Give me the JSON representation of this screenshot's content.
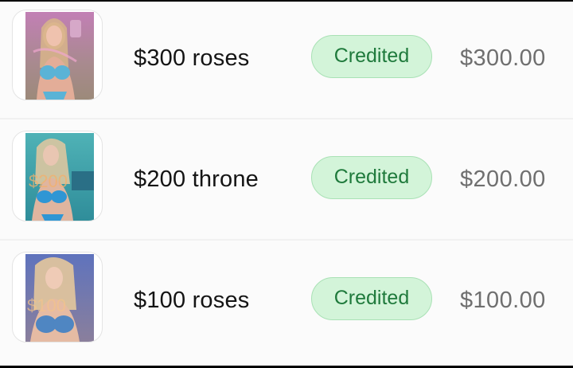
{
  "transactions": [
    {
      "title": "$300 roses",
      "status": "Credited",
      "amount": "$300.00",
      "thumbnail_icon": "photo-thumbnail",
      "thumbnail_overlay": "",
      "colors": {
        "bg": "#c97fb6",
        "accent": "#f0a6cf",
        "suit": "#5ab3d6"
      }
    },
    {
      "title": "$200 throne",
      "status": "Credited",
      "amount": "$200.00",
      "thumbnail_icon": "photo-thumbnail",
      "thumbnail_overlay": "$200",
      "colors": {
        "bg": "#3ea8ad",
        "accent": "#8fd6de",
        "suit": "#2f96d4"
      }
    },
    {
      "title": "$100 roses",
      "status": "Credited",
      "amount": "$100.00",
      "thumbnail_icon": "photo-thumbnail",
      "thumbnail_overlay": "$100",
      "colors": {
        "bg": "#6a7ec7",
        "accent": "#d9b7a8",
        "suit": "#4f86c2"
      }
    }
  ],
  "theme": {
    "badge_bg": "#d3f4d9",
    "badge_text": "#1f7a3c",
    "amount_text": "#6f6f6f",
    "title_text": "#141414"
  }
}
